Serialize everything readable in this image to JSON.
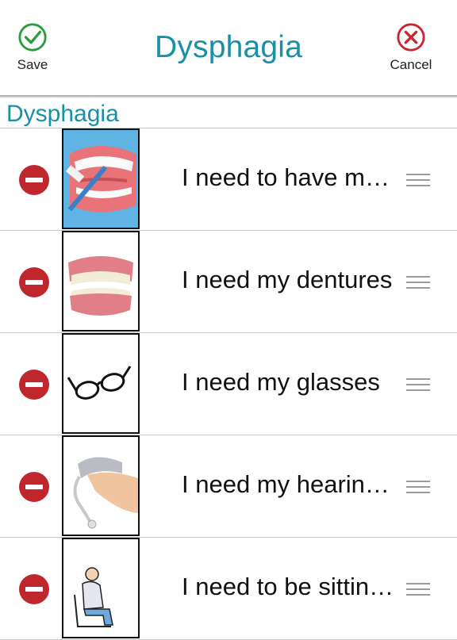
{
  "nav": {
    "title": "Dysphagia",
    "save_label": "Save",
    "cancel_label": "Cancel"
  },
  "section": {
    "title": "Dysphagia"
  },
  "items": [
    {
      "text": "I need to have my teeth brushed",
      "icon": "toothbrush-icon"
    },
    {
      "text": "I need my dentures",
      "icon": "dentures-icon"
    },
    {
      "text": "I need my glasses",
      "icon": "glasses-icon"
    },
    {
      "text": "I need my hearing aid",
      "icon": "hearing-aid-icon"
    },
    {
      "text": "I need to be sitting up",
      "icon": "sitting-person-icon"
    }
  ],
  "colors": {
    "accent": "#1a8fa8",
    "save_green": "#2e9a3e",
    "cancel_red": "#c8262e",
    "remove_red": "#c0272d"
  }
}
